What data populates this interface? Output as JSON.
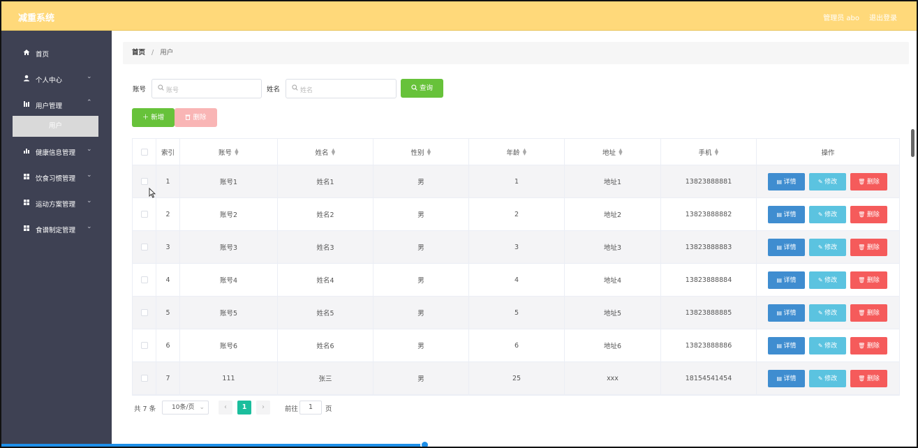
{
  "header": {
    "brand": "减重系统",
    "user": "管理员 abo",
    "logout": "退出登录"
  },
  "sidebar": {
    "items": [
      {
        "label": "首页",
        "icon": "home-icon"
      },
      {
        "label": "个人中心",
        "icon": "user-icon"
      },
      {
        "label": "用户管理",
        "icon": "list-icon"
      },
      {
        "label": "健康信息管理",
        "icon": "chart-icon"
      },
      {
        "label": "饮食习惯管理",
        "icon": "grid-icon"
      },
      {
        "label": "运动方案管理",
        "icon": "grid-icon"
      },
      {
        "label": "食谱制定管理",
        "icon": "grid-icon"
      }
    ],
    "active_sub": "用户"
  },
  "breadcrumb": {
    "home": "首页",
    "sep": "/",
    "current": "用户"
  },
  "search": {
    "account_label": "账号",
    "account_placeholder": "账号",
    "name_label": "姓名",
    "name_placeholder": "姓名",
    "query_button": "查询"
  },
  "toolbar": {
    "add_button": "新增",
    "delete_button": "删除"
  },
  "table": {
    "headers": [
      "索引",
      "账号",
      "姓名",
      "性别",
      "年龄",
      "地址",
      "手机",
      "操作"
    ],
    "rows": [
      [
        "1",
        "账号1",
        "姓名1",
        "男",
        "1",
        "地址1",
        "13823888881"
      ],
      [
        "2",
        "账号2",
        "姓名2",
        "男",
        "2",
        "地址2",
        "13823888882"
      ],
      [
        "3",
        "账号3",
        "姓名3",
        "男",
        "3",
        "地址3",
        "13823888883"
      ],
      [
        "4",
        "账号4",
        "姓名4",
        "男",
        "4",
        "地址4",
        "13823888884"
      ],
      [
        "5",
        "账号5",
        "姓名5",
        "男",
        "5",
        "地址5",
        "13823888885"
      ],
      [
        "6",
        "账号6",
        "姓名6",
        "男",
        "6",
        "地址6",
        "13823888886"
      ],
      [
        "7",
        "111",
        "张三",
        "男",
        "25",
        "xxx",
        "18154541454"
      ]
    ],
    "actions": {
      "detail": "详情",
      "edit": "修改",
      "delete": "删除"
    }
  },
  "pagination": {
    "total": "共 7 条",
    "page_size": "10条/页",
    "current_page": "1",
    "goto_prefix": "前往",
    "goto_value": "1",
    "goto_suffix": "页"
  },
  "colors": {
    "header": "#FFD97A",
    "sidebar": "#3E4153",
    "green": "#67C23A",
    "detail": "#3F8DD0",
    "edit": "#5BC3E0",
    "delete": "#F55B5B",
    "page_active": "#1BBE9D"
  }
}
